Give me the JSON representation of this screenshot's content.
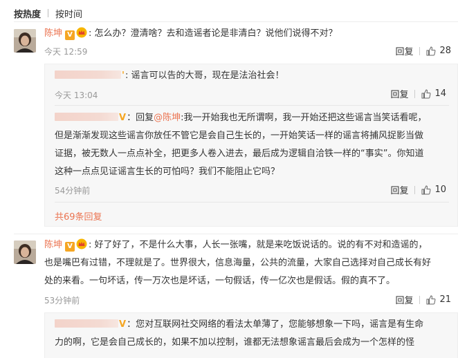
{
  "sort_bar": {
    "active": "按热度",
    "other": "按时间"
  },
  "comments": [
    {
      "user": "陈坤",
      "lines": [
        ": 怎么办？澄清啥？去和造谣者论是非清白？说他们说得不对？"
      ],
      "time": "今天 12:59",
      "reply_label": "回复",
      "likes": "28",
      "replies": [
        {
          "lines": [
            ": 谣言可以告的大哥，现在是法治社会！"
          ],
          "time": "今天 13:04",
          "reply_label": "回复",
          "likes": "14"
        },
        {
          "reply_prefix": "：回复",
          "mention": "@陈坤",
          "first_line_rest": ":我一开始我也无所谓啊，我一开始还把这些谣言当笑话看呢，",
          "lines": [
            "但是渐渐发现这些谣言你放任不管它是会自己生长的，一开始笑话一样的谣言将捕风捉影当做",
            "证据，被无数人一点点补全，把更多人卷入进去，最后成为逻辑自洽铁一样的“事实”。你知道",
            "这种一点点见证谣言生长的可怕吗？我们不能阻止它吗？"
          ],
          "time": "54分钟前",
          "reply_label": "回复",
          "likes": "10"
        }
      ],
      "more_replies": "共69条回复"
    },
    {
      "user": "陈坤",
      "lines": [
        ": 好了好了，不是什么大事，人长一张嘴，就是来吃饭说话的。说的有不对和造谣的，",
        "也是嘴巴有过错，不理就是了。世界很大，信息海量，公共的流量，大家自己选择对自己成长有好",
        "处的来看。一句坏话，传一万次也是坏话，一句假话，传一亿次也是假话。假的真不了。"
      ],
      "time": "53分钟前",
      "reply_label": "回复",
      "likes": "21",
      "replies": [
        {
          "lines": [
            "：您对互联网社交网络的看法太单薄了，您能够想象一下吗，谣言是有生命",
            "力的啊，它是会自己成长的，如果不加以控制，谁都无法想象谣言最后会成为一个怎样的怪"
          ]
        }
      ]
    }
  ],
  "colors": {
    "username": "#eb7350",
    "badge": "#f5a623",
    "time": "#999999",
    "reply_bg": "#f7f7f7"
  },
  "icons": {
    "verified": "V",
    "like": "thumbs-up-icon",
    "vip": "vip-crown-icon"
  }
}
